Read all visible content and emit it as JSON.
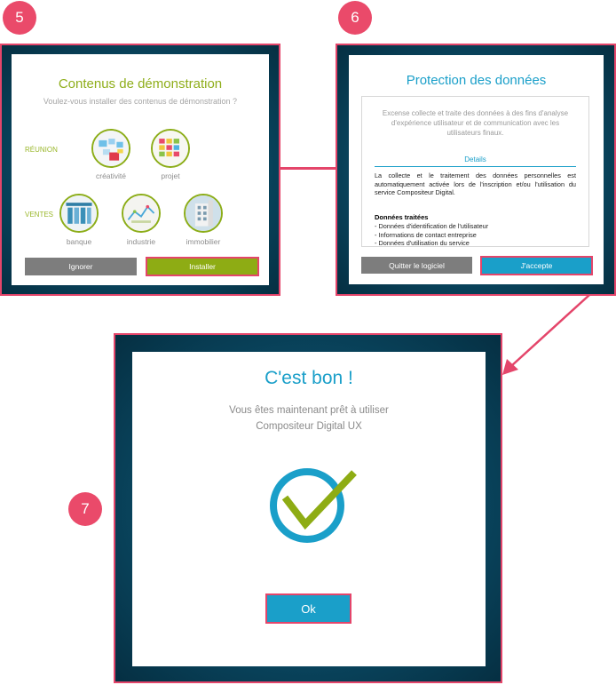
{
  "steps": [
    "5",
    "6",
    "7"
  ],
  "demo": {
    "title": "Contenus de démonstration",
    "subtitle": "Voulez-vous installer des contenus de démonstration ?",
    "categories": [
      {
        "label": "RÉUNION",
        "items": [
          {
            "label": "créativité",
            "icon": "creativity-icon"
          },
          {
            "label": "projet",
            "icon": "project-icon"
          }
        ]
      },
      {
        "label": "VENTES",
        "items": [
          {
            "label": "banque",
            "icon": "bank-icon"
          },
          {
            "label": "industrie",
            "icon": "industry-icon"
          },
          {
            "label": "immobilier",
            "icon": "real-estate-icon"
          }
        ]
      }
    ],
    "ignore_label": "Ignorer",
    "install_label": "Installer"
  },
  "privacy": {
    "title": "Protection des données",
    "intro": "Excense collecte et traite des données à des fins d'analyse d'expérience utilisateur et de communication avec les utilisateurs finaux.",
    "details_label": "Details",
    "details_text": "La collecte et le traitement des données personnelles est automatiquement activée lors de l'inscription et/ou l'utilisation du service Compositeur Digital.",
    "data_heading": "Données traitées",
    "data_items": [
      "- Données d'identification de l'utilisateur",
      "- Informations de contact entreprise",
      "- Données d'utilisation du service"
    ],
    "quit_label": "Quitter le logiciel",
    "accept_label": "J'accepte"
  },
  "done": {
    "title": "C'est bon !",
    "message_line1": "Vous êtes maintenant prêt à utiliser",
    "message_line2": "Compositeur Digital UX",
    "ok_label": "Ok"
  },
  "colors": {
    "accent_pink": "#e4456a",
    "green": "#8cad18",
    "blue": "#1a9fc9",
    "gray_button": "#7d7d7d"
  }
}
